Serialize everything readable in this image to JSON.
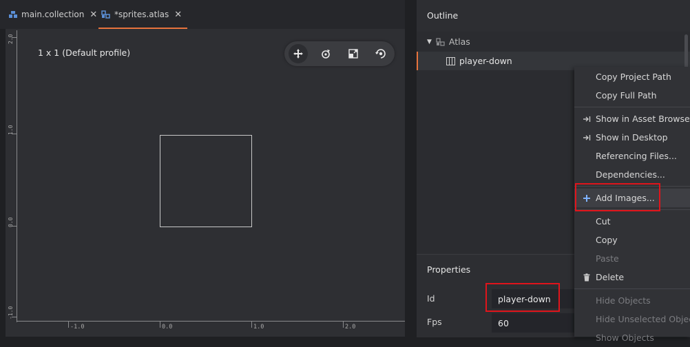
{
  "tabs": [
    {
      "label": "main.collection",
      "icon": "collection-icon",
      "active": false
    },
    {
      "label": "*sprites.atlas",
      "icon": "atlas-icon",
      "active": true
    }
  ],
  "scene": {
    "profile": "1 x 1 (Default profile)",
    "tools": [
      "move-tool-icon",
      "rotate-tool-icon",
      "scale-tool-icon",
      "camera-reset-icon"
    ],
    "ruler_v": [
      "2.0",
      "1.0",
      "0.0",
      "-1.0"
    ],
    "ruler_h": [
      "-1.0",
      "0.0",
      "1.0",
      "2.0"
    ]
  },
  "outline": {
    "title": "Outline",
    "root": "Atlas",
    "child": "player-down"
  },
  "properties": {
    "title": "Properties",
    "id_label": "Id",
    "id_value": "player-down",
    "fps_label": "Fps",
    "fps_value": "60"
  },
  "context_menu": {
    "copy_project_path": "Copy Project Path",
    "copy_full_path": "Copy Full Path",
    "show_in_asset_browser": "Show in Asset Browser",
    "show_in_desktop": "Show in Desktop",
    "referencing_files": "Referencing Files...",
    "dependencies": "Dependencies...",
    "add_images": "Add Images...",
    "cut": "Cut",
    "copy": "Copy",
    "paste": "Paste",
    "delete": "Delete",
    "hide_objects": "Hide Objects",
    "hide_unselected_objects": "Hide Unselected Objects",
    "show_objects": "Show Objects"
  },
  "colors": {
    "accent": "#e9743d",
    "highlight_box": "#e1141b"
  }
}
